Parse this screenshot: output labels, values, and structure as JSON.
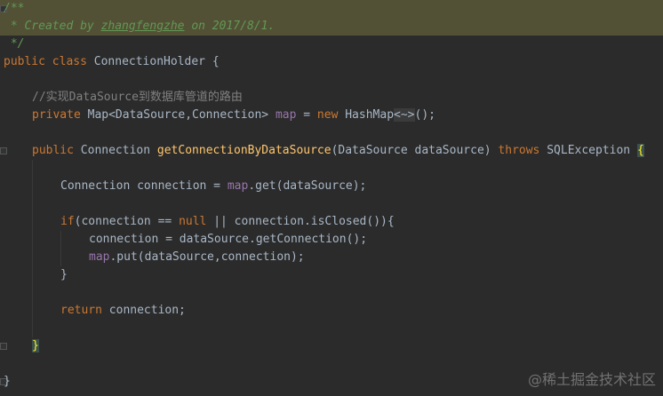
{
  "editor": {
    "doc_comment": {
      "open": "/**",
      "created_prefix": " * Created by ",
      "author": "zhangfengzhe",
      "created_suffix": " on 2017/8/1.",
      "close": " */"
    },
    "class_decl": {
      "modifier": "public",
      "keyword": "class",
      "name": "ConnectionHolder",
      "brace": "{"
    },
    "comment_line": "//实现DataSource到数据库管道的路由",
    "field_decl": {
      "modifier": "private",
      "type": "Map<DataSource,Connection>",
      "name": "map",
      "assign": "=",
      "new_kw": "new",
      "ctor": "HashMap",
      "diamond": "<~>",
      "tail": "();"
    },
    "method_decl": {
      "modifier": "public",
      "return_type": "Connection",
      "name": "getConnectionByDataSource",
      "params": "(DataSource dataSource)",
      "throws_kw": "throws",
      "exception": "SQLException",
      "brace": "{"
    },
    "line_get": {
      "type": "Connection connection = ",
      "field": "map",
      "rest": ".get(dataSource);"
    },
    "line_if": {
      "kw": "if",
      "pre": "(connection == ",
      "null_kw": "null",
      "post": " || connection.isClosed()){"
    },
    "line_assign": "connection = dataSource.getConnection();",
    "line_put": {
      "field": "map",
      "rest": ".put(dataSource,connection);"
    },
    "close_if": "}",
    "line_return": {
      "kw": "return",
      "rest": " connection;"
    },
    "close_method": "}",
    "close_class": "}"
  },
  "watermark": "@稀土掘金技术社区",
  "colors": {
    "background": "#2b2b2b",
    "keyword": "#cc7832",
    "field": "#9876aa",
    "method": "#ffc66d",
    "comment": "#808080",
    "doc_comment": "#629755",
    "text": "#a9b7c6"
  }
}
